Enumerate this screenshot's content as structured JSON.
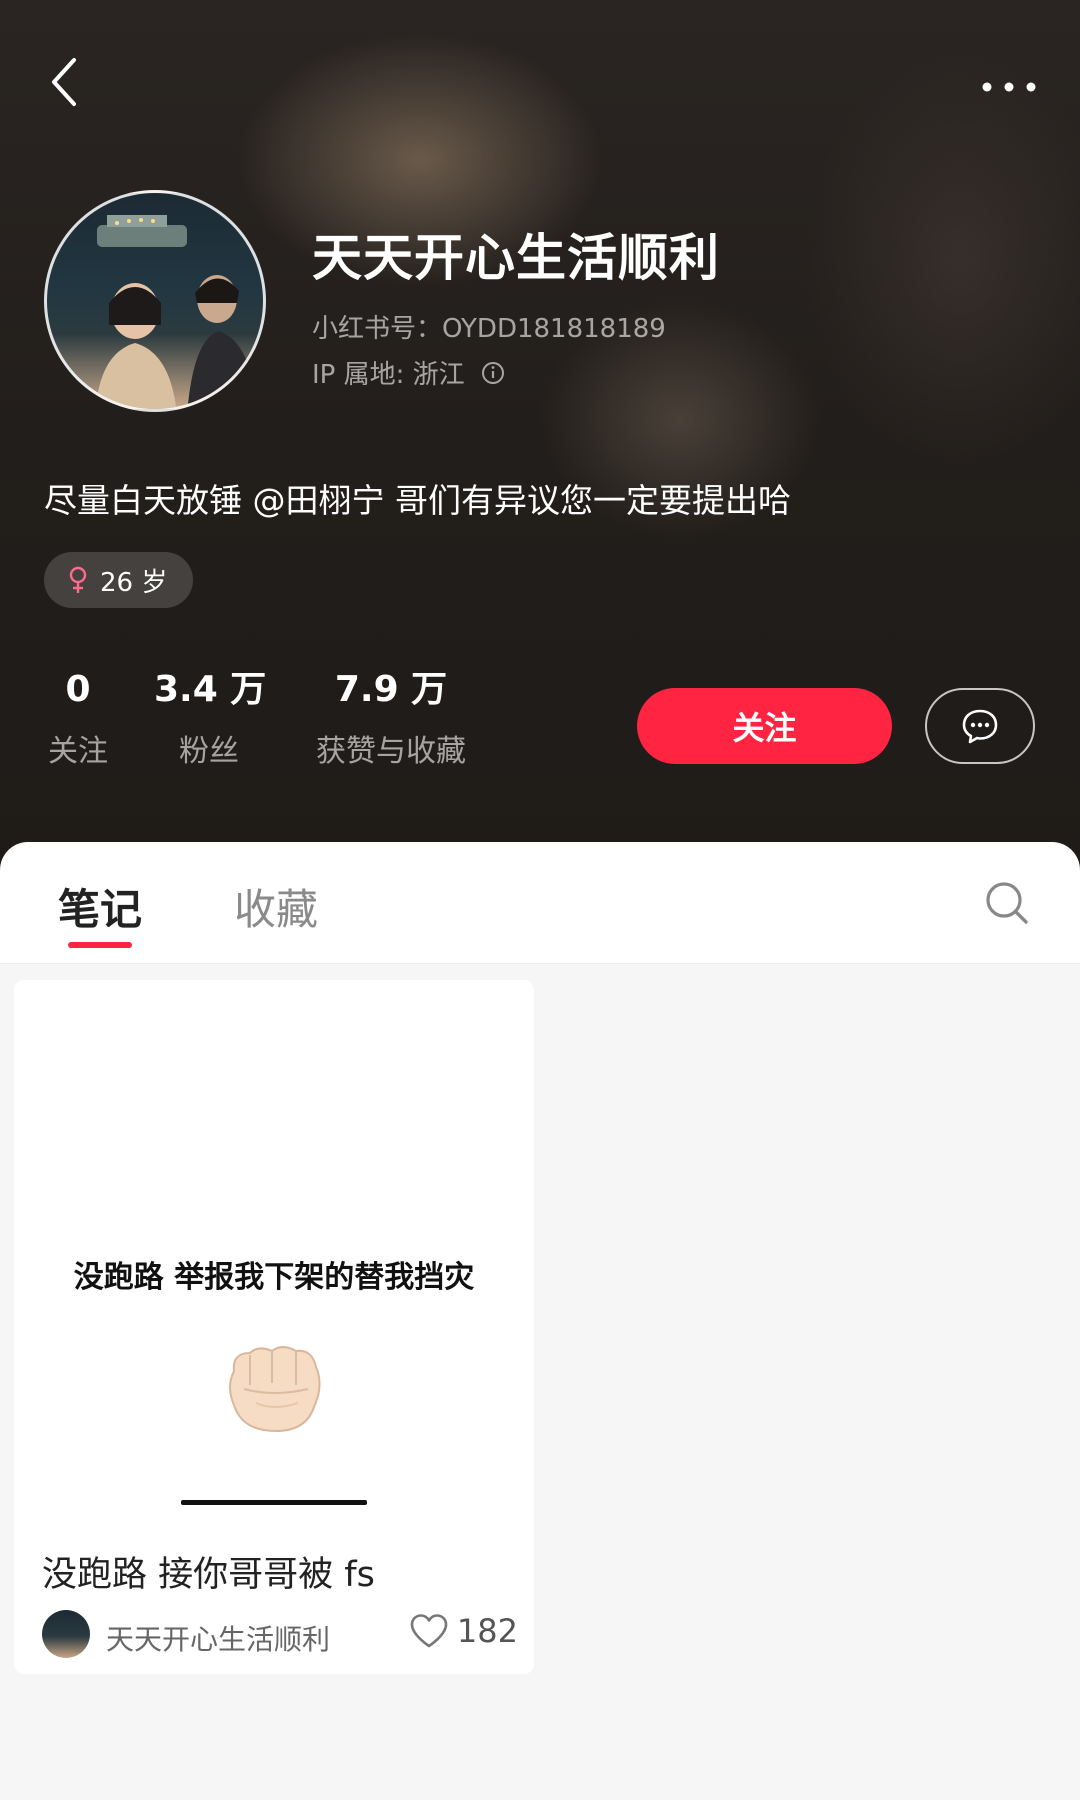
{
  "profile": {
    "name": "天天开心生活顺利",
    "id_label": "小红书号：OYDD181818189",
    "ip_label": "IP 属地: 浙江",
    "bio": "尽量白天放锤 @田栩宁 哥们有异议您一定要提出哈",
    "tag": "26 岁"
  },
  "stats": {
    "following": {
      "value": "0",
      "label": "关注"
    },
    "fans": {
      "value": "3.4 万",
      "label": "粉丝"
    },
    "likes": {
      "value": "7.9 万",
      "label": "获赞与收藏"
    }
  },
  "actions": {
    "follow_label": "关注"
  },
  "tabs": {
    "notes": "笔记",
    "collect": "收藏"
  },
  "note": {
    "cover_text": "没跑路 举报我下架的替我挡灾",
    "title": "没跑路 接你哥哥被 fs",
    "author": "天天开心生活顺利",
    "likes": "182"
  },
  "colors": {
    "accent": "#ff2442",
    "header_bg": "#221e1b"
  },
  "icons": [
    "back-icon",
    "more-icon",
    "info-icon",
    "female-icon",
    "message-icon",
    "search-icon",
    "fist-icon",
    "heart-icon"
  ]
}
